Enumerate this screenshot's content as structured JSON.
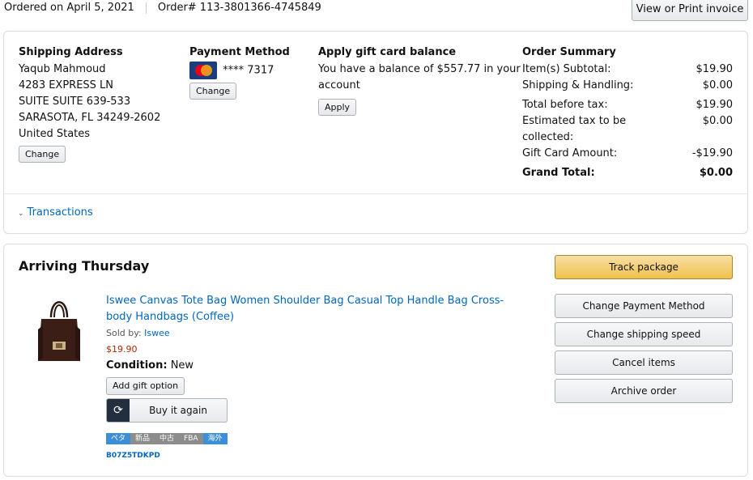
{
  "header": {
    "ordered_on": "Ordered on April 5, 2021",
    "order_number": "Order# 113-3801366-4745849",
    "invoice_button": "View or Print invoice"
  },
  "shipping": {
    "title": "Shipping Address",
    "lines": [
      "Yaqub Mahmoud",
      "4283 EXPRESS LN",
      "SUITE SUITE 639-533",
      "SARASOTA, FL 34249-2602",
      "United States"
    ],
    "change_label": "Change"
  },
  "payment": {
    "title": "Payment Method",
    "card_icon": "mastercard-icon",
    "card_number": "**** 7317",
    "change_label": "Change"
  },
  "gift_card": {
    "title": "Apply gift card balance",
    "text": "You have a balance of $557.77 in your account",
    "apply_label": "Apply"
  },
  "summary": {
    "title": "Order Summary",
    "rows": [
      {
        "label": "Item(s) Subtotal:",
        "value": "$19.90"
      },
      {
        "label": "Shipping & Handling:",
        "value": "$0.00"
      },
      {
        "label": "Total before tax:",
        "value": "$19.90"
      },
      {
        "label": "Estimated tax to be collected:",
        "value": "$0.00"
      },
      {
        "label": "Gift Card Amount:",
        "value": "-$19.90"
      }
    ],
    "grand_total_label": "Grand Total:",
    "grand_total_value": "$0.00"
  },
  "transactions_label": "Transactions",
  "shipment": {
    "status": "Arriving Thursday",
    "product": {
      "title": "Iswee Canvas Tote Bag Women Shoulder Bag Casual Top Handle Bag Cross-body Handbags (Coffee)",
      "sold_by_label": "Sold by:",
      "seller": "Iswee",
      "price": "$19.90",
      "condition_label": "Condition:",
      "condition": "New",
      "gift_option_label": "Add gift option",
      "buy_again_label": "Buy it again",
      "tags": [
        {
          "label": "ペタ",
          "color": "#3b8fd9"
        },
        {
          "label": "新品",
          "color": "#8c8c8c"
        },
        {
          "label": "中古",
          "color": "#8c8c8c"
        },
        {
          "label": "FBA",
          "color": "#8c8c8c"
        },
        {
          "label": "海外",
          "color": "#3b8fd9"
        }
      ],
      "asin": "B07Z5TDKPD"
    },
    "actions": {
      "track": "Track package",
      "change_payment": "Change Payment Method",
      "change_speed": "Change shipping speed",
      "cancel": "Cancel items",
      "archive": "Archive order"
    }
  },
  "colors": {
    "link": "#0066c0",
    "price": "#b12704",
    "primary_button": "#f0c14b"
  }
}
